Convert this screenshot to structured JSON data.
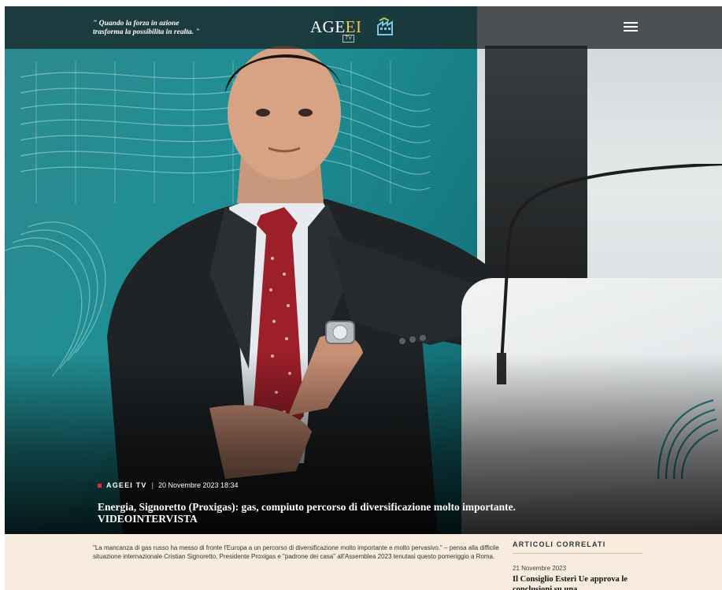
{
  "header": {
    "motto": "\" Quando la forza in azione\ntrasforma la possibilita in realta. \"",
    "logo_text_a": "AGE",
    "logo_text_b": "EI",
    "logo_tv": "TV",
    "menu_icon": "hamburger-menu-icon"
  },
  "hero": {
    "category": "AGEEI TV",
    "separator": "|",
    "date": "20 Novembre 2023 18:34",
    "headline": "Energia, Signoretto (Proxigas): gas, compiuto percorso di diversificazione molto importante. VIDEOINTERVISTA"
  },
  "article": {
    "lead": "\"La mancanza di gas russo ha messo di fronte l'Europa a un percorso di diversificazione molto importante e molto pervasivo.\" – pensa alla difficile situazione internazionale Cristian Signoretto, Presidente Proxigas e \"padrone dei casa\" all'Assemblea 2023 tenutasi questo pomeriggio a Roma."
  },
  "related": {
    "title": "ARTICOLI CORRELATI",
    "items": [
      {
        "date": "21 Novembre 2023",
        "headline": "Il Consiglio Esteri Ue approva le conclusioni su una"
      }
    ]
  },
  "colors": {
    "accent_red": "#e03030",
    "bottom_bg": "#f7ecdd",
    "topbar_bg": "#181c1e"
  }
}
